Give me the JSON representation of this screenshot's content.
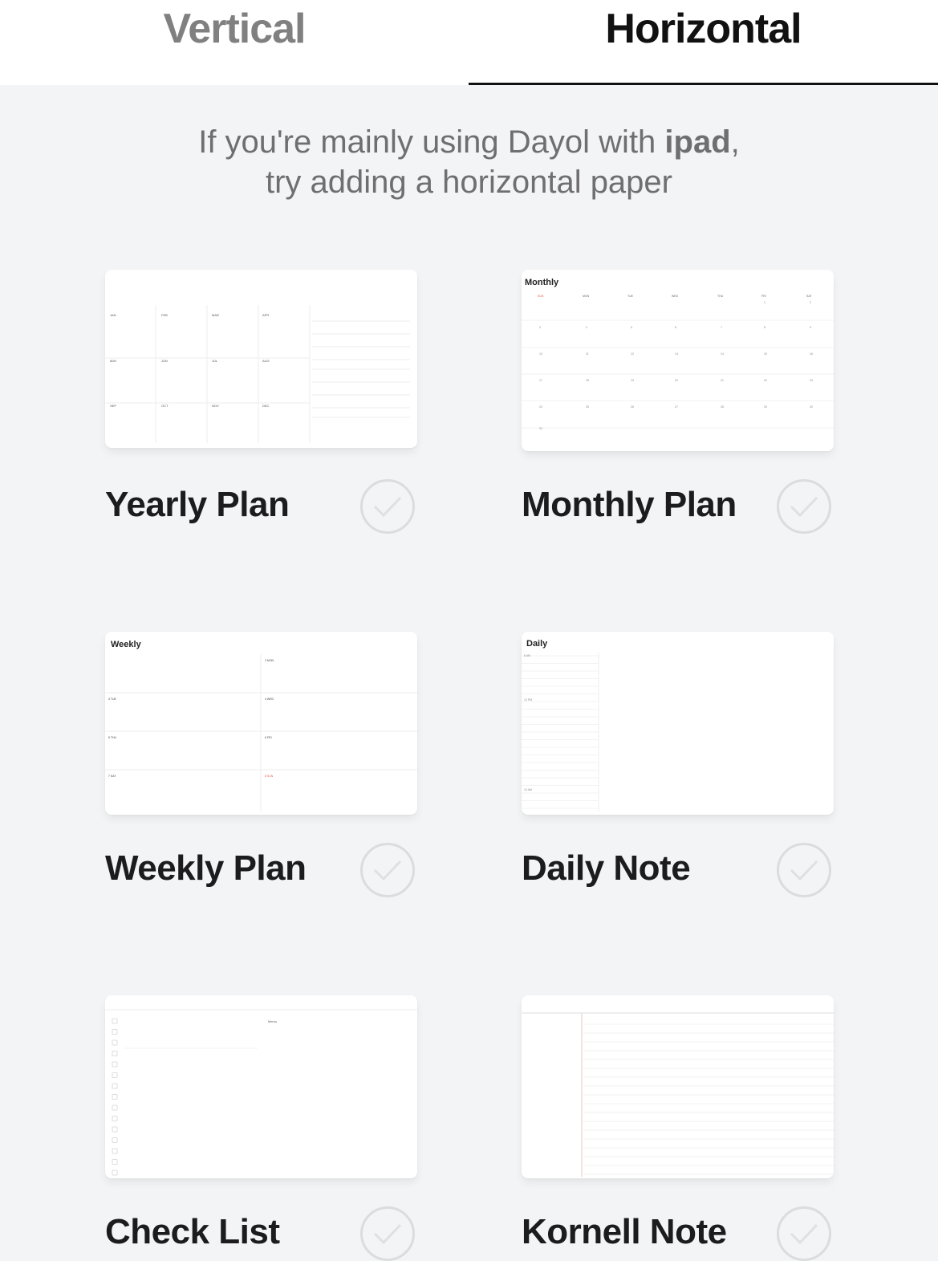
{
  "tabs": [
    {
      "label": "Vertical",
      "selected": false
    },
    {
      "label": "Horizontal",
      "selected": true
    }
  ],
  "intro": {
    "line1_prefix": "If you're mainly using Dayol with ",
    "line1_bold": "ipad",
    "line1_suffix": ",",
    "line2": "try adding a horizontal paper"
  },
  "papers": [
    {
      "title": "Yearly Plan",
      "checked": false,
      "preview": {
        "months": [
          "JAN",
          "FEB",
          "MAR",
          "APR",
          "MAY",
          "JUN",
          "JUL",
          "AUG",
          "SEP",
          "OCT",
          "NOV",
          "DEC"
        ]
      }
    },
    {
      "title": "Monthly Plan",
      "checked": false,
      "preview": {
        "heading": "Monthly",
        "weekdays": [
          "SUN",
          "MON",
          "TUE",
          "WED",
          "THU",
          "FRI",
          "SAT"
        ]
      }
    },
    {
      "title": "Weekly Plan",
      "checked": false,
      "preview": {
        "heading": "Weekly",
        "days": [
          "2 MON",
          "3 TUE",
          "4 WED",
          "5 THU",
          "6 FRI",
          "7 SAT",
          "8 SUN"
        ]
      }
    },
    {
      "title": "Daily Note",
      "checked": false,
      "preview": {
        "heading": "Daily",
        "first_hour": "6 AM",
        "noon": "12 PM",
        "midnight": "12 AM"
      }
    },
    {
      "title": "Check List",
      "checked": false,
      "preview": {
        "memo_label": "Memo"
      }
    },
    {
      "title": "Kornell Note",
      "checked": false,
      "preview": {}
    }
  ],
  "colors": {
    "background": "#f3f4f6",
    "active_tab": "#111111",
    "inactive_tab": "#808080",
    "sunday_red": "#e05a4f",
    "check_ring": "#dcdcde"
  }
}
